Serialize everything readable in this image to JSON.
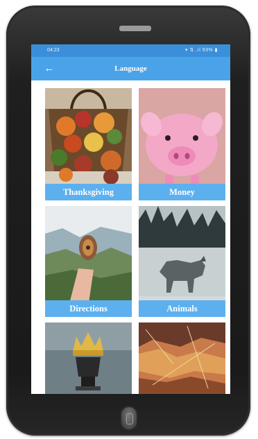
{
  "status_bar": {
    "time": "04:23",
    "right_text": "▾ ⇅ .ıl 93% ▮"
  },
  "app_bar": {
    "back_icon": "back-arrow-icon",
    "back_glyph": "←",
    "title": "Language"
  },
  "tiles": [
    {
      "label": "Thanksgiving"
    },
    {
      "label": "Money"
    },
    {
      "label": "Directions"
    },
    {
      "label": "Animals"
    },
    {
      "label": ""
    },
    {
      "label": ""
    }
  ],
  "colors": {
    "app_bar": "#4aa3e8",
    "status_bar": "#3b8fda",
    "tile_label_bg": "#5db0ee",
    "device_body": "#1f1f1f"
  }
}
